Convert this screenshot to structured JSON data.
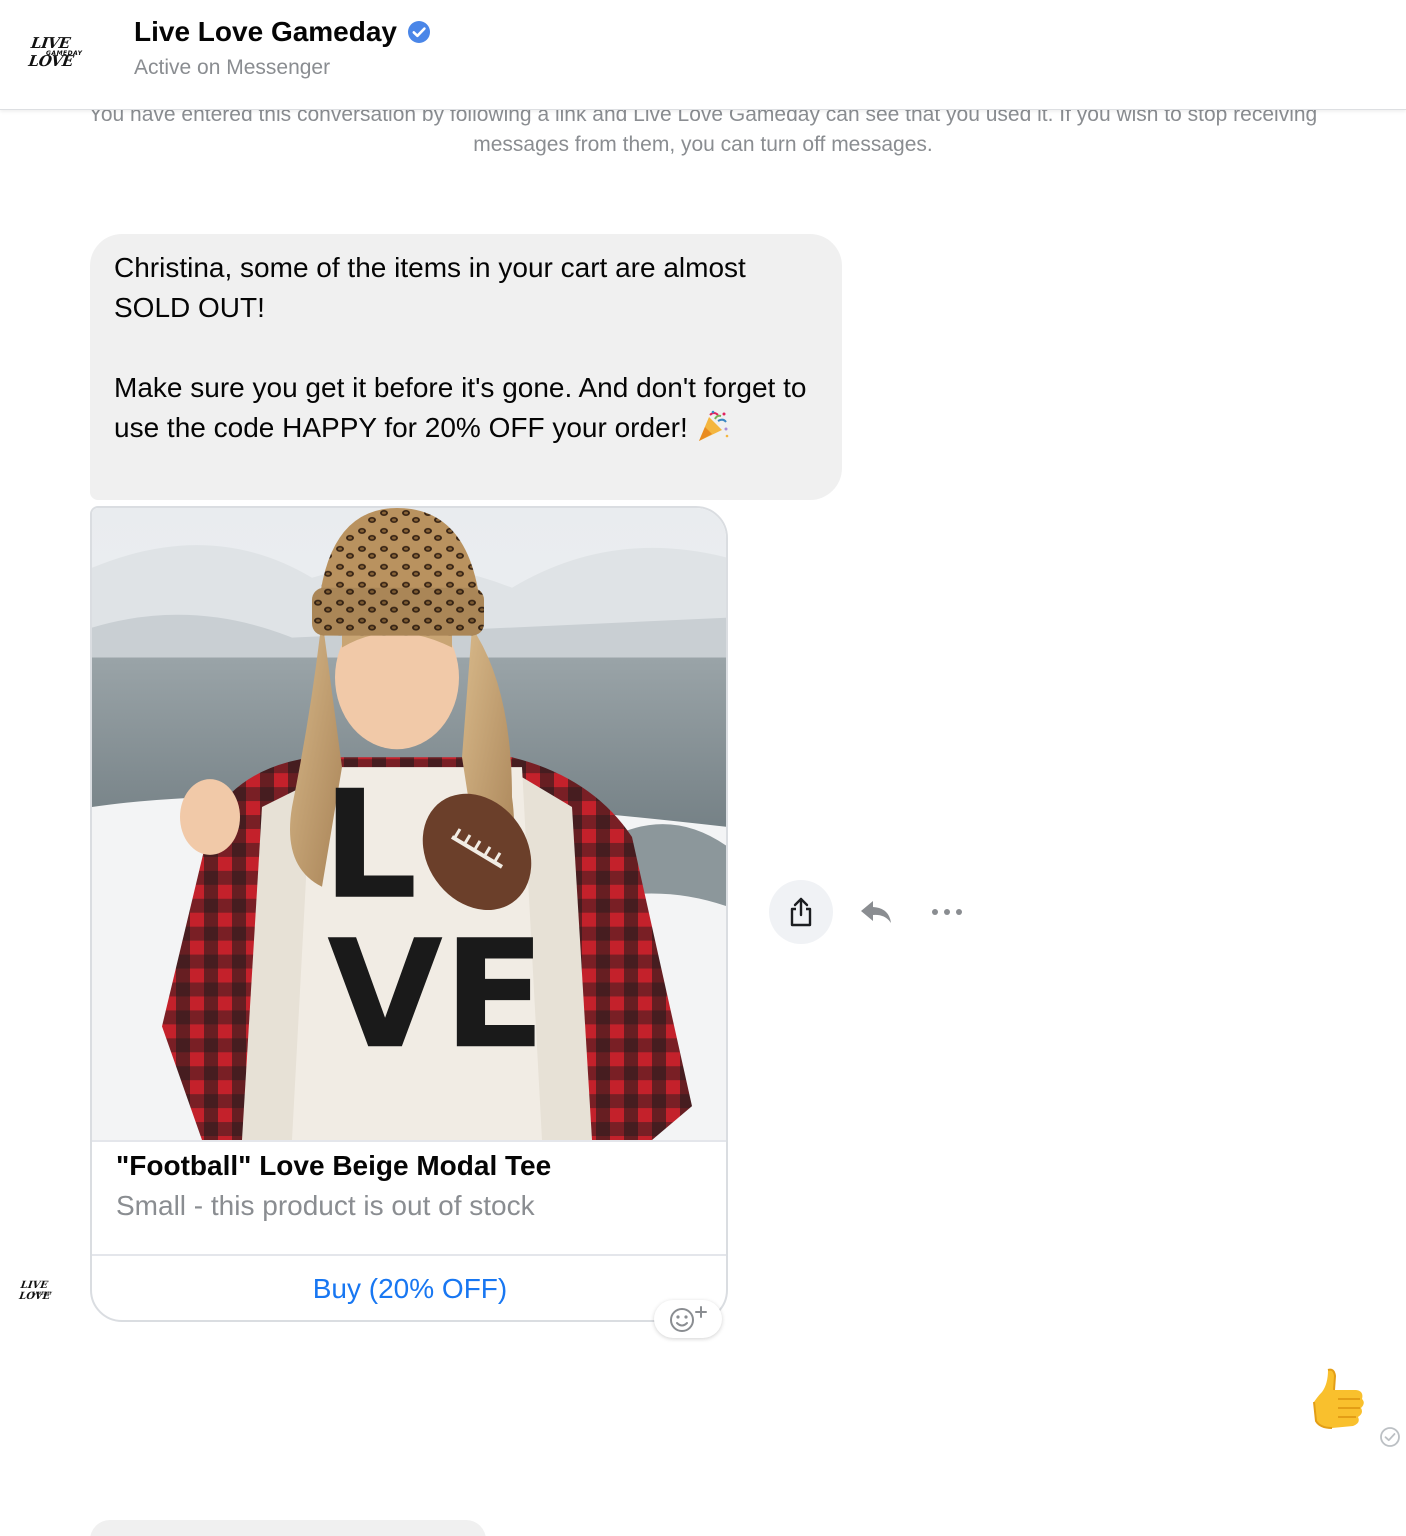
{
  "header": {
    "logo_main": "LIVE LOVE",
    "logo_sub": "GAMEDAY",
    "title": "Live Love Gameday",
    "status": "Active on Messenger"
  },
  "notice": {
    "text": "You have entered this conversation by following a link and Live Love Gameday can see that you used it. If you wish to stop receiving messages from them, you can turn off messages."
  },
  "message": {
    "line1": "Christina, some of the items in your cart are almost SOLD OUT!",
    "line2": "Make sure you get it before it's gone. And don't forget to use the code HAPPY for 20% OFF your order!",
    "emoji": "party-popper"
  },
  "product": {
    "shirt_letters_top": "L",
    "shirt_letters_bottom": "VE",
    "title": "\"Football\" Love Beige Modal Tee",
    "subtitle": "Small - this product is out of stock",
    "button_label": "Buy (20% OFF)"
  },
  "avatar": {
    "logo_main": "LIVE LOVE",
    "logo_sub": "GAMEDAY"
  },
  "reply": {
    "emoji": "thumbs-up"
  },
  "colors": {
    "accent": "#1877f2",
    "bubble_bg": "#f0f0f0",
    "muted_text": "#8a8d91",
    "verified_badge": "#4a86e8"
  }
}
